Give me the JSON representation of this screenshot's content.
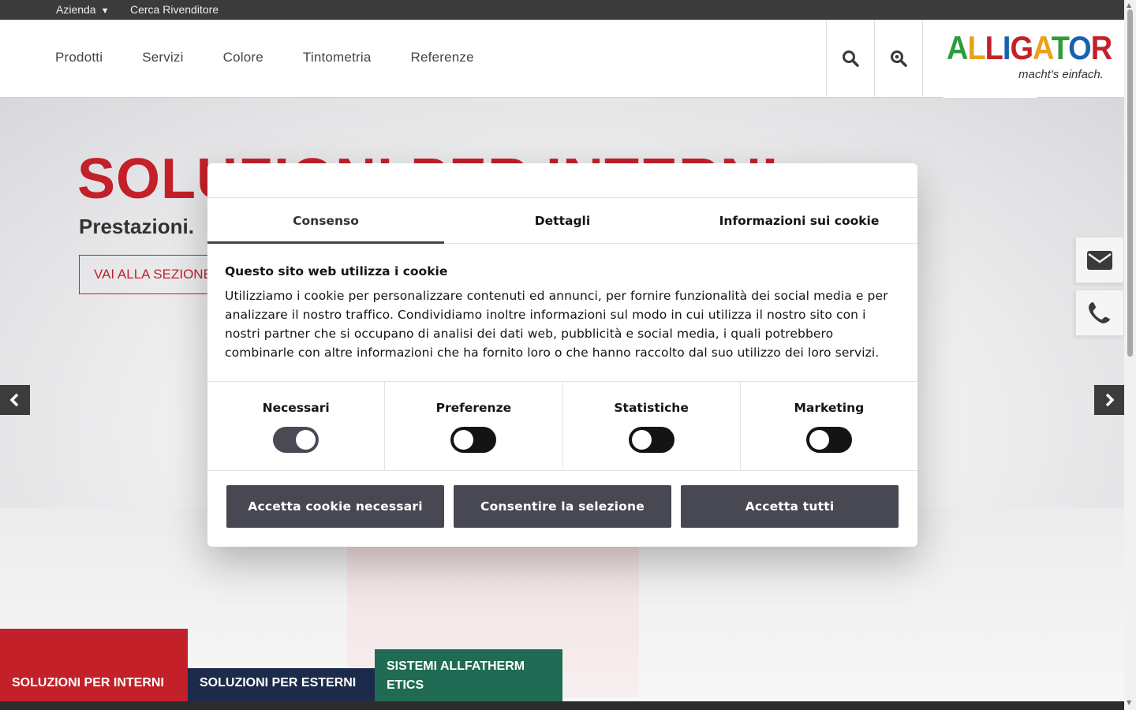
{
  "topbar": {
    "azienda": "Azienda",
    "caret": "▼",
    "cerca": "Cerca Rivenditore"
  },
  "nav": {
    "items": [
      "Prodotti",
      "Servizi",
      "Colore",
      "Tintometria",
      "Referenze"
    ]
  },
  "logo": {
    "letters": [
      "A",
      "L",
      "L",
      "I",
      "G",
      "A",
      "T",
      "O",
      "R"
    ],
    "letter_colors": [
      "#2e9c3a",
      "#e8a21a",
      "#c3202a",
      "#1b5fb0",
      "#c3202a",
      "#e8a21a",
      "#2e9c3a",
      "#1b5fb0",
      "#c3202a"
    ],
    "tagline": "macht's einfach."
  },
  "hero": {
    "title": "SOLUZIONI PER INTERNI",
    "subtitle": "Prestazioni.",
    "button": "VAI ALLA SEZIONE"
  },
  "categories": {
    "interni": "SOLUZIONI PER INTERNI",
    "esterni": "SOLUZIONI PER ESTERNI",
    "allfatherm": "SISTEMI ALLFATHERM ETICS"
  },
  "icons": {
    "search": "search-icon",
    "zoom": "zoom-search-icon",
    "mail": "mail-icon",
    "phone": "phone-icon",
    "prev": "chevron-left-icon",
    "next": "chevron-right-icon"
  },
  "colors": {
    "brand_red": "#c3202a",
    "navy": "#1c2b4b",
    "green": "#1f6b53",
    "dialog_button": "#484852"
  },
  "cookie": {
    "tabs": [
      "Consenso",
      "Dettagli",
      "Informazioni sui cookie"
    ],
    "active_tab": "Consenso",
    "title": "Questo sito web utilizza i cookie",
    "text": "Utilizziamo i cookie per personalizzare contenuti ed annunci, per fornire funzionalità dei social media e per analizzare il nostro traffico. Condividiamo inoltre informazioni sul modo in cui utilizza il nostro sito con i nostri partner che si occupano di analisi dei dati web, pubblicità e social media, i quali potrebbero combinarle con altre informazioni che ha fornito loro o che hanno raccolto dal suo utilizzo dei loro servizi.",
    "toggles": [
      {
        "label": "Necessari",
        "on": true
      },
      {
        "label": "Preferenze",
        "on": false
      },
      {
        "label": "Statistiche",
        "on": false
      },
      {
        "label": "Marketing",
        "on": false
      }
    ],
    "buttons": {
      "necessary": "Accetta cookie necessari",
      "selection": "Consentire la selezione",
      "all": "Accetta tutti"
    }
  }
}
